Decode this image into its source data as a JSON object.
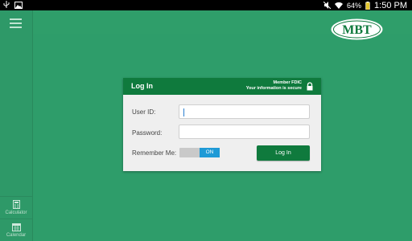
{
  "statusbar": {
    "battery_percent": "64%",
    "time": "1:50 PM"
  },
  "sidebar": {
    "items": [
      {
        "label": "Calculator",
        "icon": "calculator-icon"
      },
      {
        "label": "Calendar",
        "icon": "calendar-icon"
      }
    ]
  },
  "logo": {
    "text": "MBT"
  },
  "login": {
    "title": "Log In",
    "fdic_line1": "Member FDIC",
    "fdic_line2": "Your information is secure",
    "user_id_label": "User ID:",
    "user_id_value": "",
    "password_label": "Password:",
    "password_value": "",
    "remember_label": "Remember Me:",
    "remember_state": "ON",
    "button_label": "Log In"
  },
  "colors": {
    "background": "#2e9d6a",
    "brand_green": "#0f7a3d",
    "toggle_on": "#1f9ad6"
  }
}
